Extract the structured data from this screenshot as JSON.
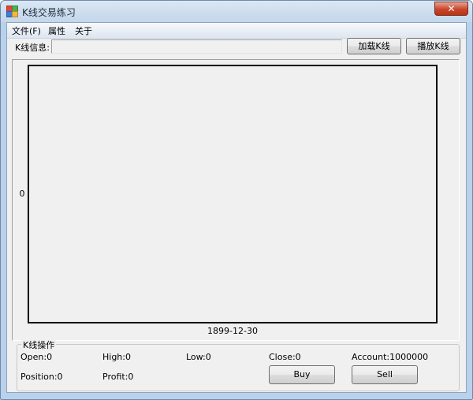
{
  "window": {
    "title": "K线交易练习",
    "close_glyph": "✕"
  },
  "menu": {
    "items": [
      "文件(F)",
      "属性",
      "关于"
    ]
  },
  "kline_info": {
    "label": "K线信息:",
    "value": "",
    "load_button": "加载K线",
    "play_button": "播放K线"
  },
  "chart": {
    "y_label": "0",
    "x_label": "1899-12-30"
  },
  "chart_data": {
    "type": "line",
    "title": "",
    "x": [
      "1899-12-30"
    ],
    "y_tick_labels": [
      "0"
    ],
    "series": [],
    "grid": false
  },
  "operations": {
    "group_title": "K线操作",
    "open": "Open:0",
    "high": "High:0",
    "low": "Low:0",
    "close": "Close:0",
    "account": "Account:1000000",
    "position": "Position:0",
    "profit": "Profit:0",
    "buy_button": "Buy",
    "sell_button": "Sell"
  },
  "colors": {
    "window_frame": "#b9d1ea",
    "client_bg": "#f0f0f0",
    "close_button": "#c9452a"
  }
}
